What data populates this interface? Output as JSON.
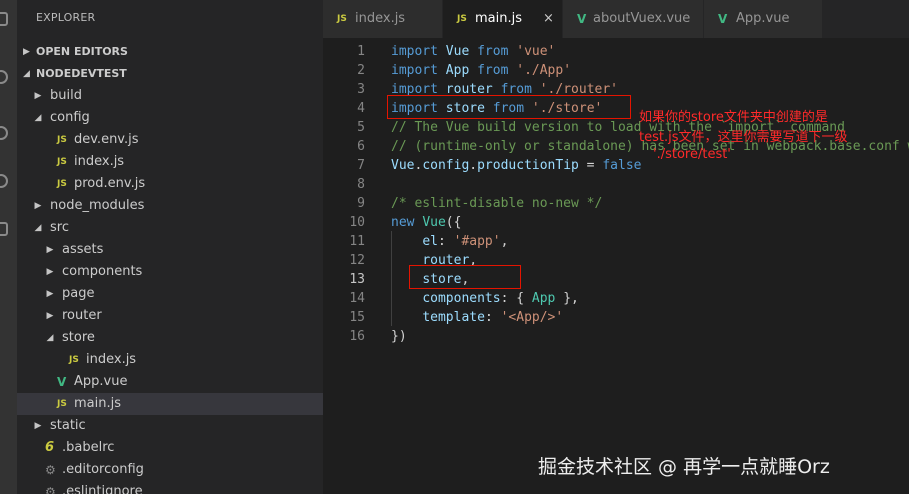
{
  "sidebar": {
    "title": "EXPLORER",
    "open_editors_label": "OPEN EDITORS",
    "project_label": "NODEDEVTEST",
    "tree": [
      {
        "label": "build",
        "kind": "folder",
        "expanded": false
      },
      {
        "label": "config",
        "kind": "folder",
        "expanded": true
      },
      {
        "label": "dev.env.js",
        "kind": "js"
      },
      {
        "label": "index.js",
        "kind": "js"
      },
      {
        "label": "prod.env.js",
        "kind": "js"
      },
      {
        "label": "node_modules",
        "kind": "folder",
        "expanded": false
      },
      {
        "label": "src",
        "kind": "folder",
        "expanded": true
      },
      {
        "label": "assets",
        "kind": "folder",
        "expanded": false
      },
      {
        "label": "components",
        "kind": "folder",
        "expanded": false
      },
      {
        "label": "page",
        "kind": "folder",
        "expanded": false
      },
      {
        "label": "router",
        "kind": "folder",
        "expanded": false
      },
      {
        "label": "store",
        "kind": "folder",
        "expanded": true
      },
      {
        "label": "index.js",
        "kind": "js"
      },
      {
        "label": "App.vue",
        "kind": "vue"
      },
      {
        "label": "main.js",
        "kind": "js",
        "selected": true
      },
      {
        "label": "static",
        "kind": "folder",
        "expanded": false
      },
      {
        "label": ".babelrc",
        "kind": "babel"
      },
      {
        "label": ".editorconfig",
        "kind": "config"
      },
      {
        "label": ".eslintignore",
        "kind": "config"
      }
    ]
  },
  "icons": {
    "js": "JS",
    "vue": "V",
    "babel": "6",
    "config": "⚙",
    "collapsed": "▶",
    "expanded": "◢",
    "close": "×"
  },
  "tabs": [
    {
      "label": "index.js",
      "icon": "JS",
      "active": false
    },
    {
      "label": "main.js",
      "icon": "JS",
      "active": true,
      "close": "×"
    },
    {
      "label": "aboutVuex.vue",
      "icon": "V",
      "active": false
    },
    {
      "label": "App.vue",
      "icon": "V",
      "active": false
    }
  ],
  "editor": {
    "current_line": 13,
    "line_numbers": [
      "1",
      "2",
      "3",
      "4",
      "5",
      "6",
      "7",
      "8",
      "9",
      "10",
      "11",
      "12",
      "13",
      "14",
      "15",
      "16"
    ],
    "lines": [
      [
        {
          "t": "import",
          "c": "kw"
        },
        {
          "t": " ",
          "c": "pl"
        },
        {
          "t": "Vue",
          "c": "id"
        },
        {
          "t": " ",
          "c": "pl"
        },
        {
          "t": "from",
          "c": "kw"
        },
        {
          "t": " ",
          "c": "pl"
        },
        {
          "t": "'vue'",
          "c": "str"
        }
      ],
      [
        {
          "t": "import",
          "c": "kw"
        },
        {
          "t": " ",
          "c": "pl"
        },
        {
          "t": "App",
          "c": "id"
        },
        {
          "t": " ",
          "c": "pl"
        },
        {
          "t": "from",
          "c": "kw"
        },
        {
          "t": " ",
          "c": "pl"
        },
        {
          "t": "'./App'",
          "c": "str"
        }
      ],
      [
        {
          "t": "import",
          "c": "kw"
        },
        {
          "t": " ",
          "c": "pl"
        },
        {
          "t": "router",
          "c": "id"
        },
        {
          "t": " ",
          "c": "pl"
        },
        {
          "t": "from",
          "c": "kw"
        },
        {
          "t": " ",
          "c": "pl"
        },
        {
          "t": "'./router'",
          "c": "str"
        }
      ],
      [
        {
          "t": "import",
          "c": "kw"
        },
        {
          "t": " ",
          "c": "pl"
        },
        {
          "t": "store",
          "c": "id"
        },
        {
          "t": " ",
          "c": "pl"
        },
        {
          "t": "from",
          "c": "kw"
        },
        {
          "t": " ",
          "c": "pl"
        },
        {
          "t": "'./store'",
          "c": "str"
        }
      ],
      [
        {
          "t": "// The Vue build version to load with the `import` command",
          "c": "cmt"
        }
      ],
      [
        {
          "t": "// (runtime-only or standalone) has been set in webpack.base.conf with an alias.",
          "c": "cmt"
        }
      ],
      [
        {
          "t": "Vue",
          "c": "id"
        },
        {
          "t": ".",
          "c": "pl"
        },
        {
          "t": "config",
          "c": "id"
        },
        {
          "t": ".",
          "c": "pl"
        },
        {
          "t": "productionTip",
          "c": "id"
        },
        {
          "t": " = ",
          "c": "pl"
        },
        {
          "t": "false",
          "c": "kw"
        }
      ],
      [],
      [
        {
          "t": "/* eslint-disable no-new */",
          "c": "cmt"
        }
      ],
      [
        {
          "t": "new",
          "c": "kw"
        },
        {
          "t": " ",
          "c": "pl"
        },
        {
          "t": "Vue",
          "c": "cls"
        },
        {
          "t": "({",
          "c": "pl"
        }
      ],
      [
        {
          "t": "    ",
          "c": "pl"
        },
        {
          "t": "el",
          "c": "id"
        },
        {
          "t": ": ",
          "c": "pl"
        },
        {
          "t": "'#app'",
          "c": "str"
        },
        {
          "t": ",",
          "c": "pl"
        }
      ],
      [
        {
          "t": "    ",
          "c": "pl"
        },
        {
          "t": "router",
          "c": "id"
        },
        {
          "t": ",",
          "c": "pl"
        }
      ],
      [
        {
          "t": "    ",
          "c": "pl"
        },
        {
          "t": "store",
          "c": "id"
        },
        {
          "t": ",",
          "c": "pl"
        }
      ],
      [
        {
          "t": "    ",
          "c": "pl"
        },
        {
          "t": "components",
          "c": "id"
        },
        {
          "t": ": { ",
          "c": "pl"
        },
        {
          "t": "App",
          "c": "cls"
        },
        {
          "t": " },",
          "c": "pl"
        }
      ],
      [
        {
          "t": "    ",
          "c": "pl"
        },
        {
          "t": "template",
          "c": "id"
        },
        {
          "t": ": ",
          "c": "pl"
        },
        {
          "t": "'<App/>'",
          "c": "str"
        }
      ],
      [
        {
          "t": "})",
          "c": "pl"
        }
      ]
    ]
  },
  "annotation": {
    "line1": "如果你的store文件夹中创建的是",
    "line2": "test.js文件，这里你需要写道下一级",
    "line3": "'./store/test'"
  },
  "watermark": "掘金技术社区 @ 再学一点就睡Orz",
  "colors": {
    "annotation": "#ff2a2a",
    "highlight_box": "#e51400"
  }
}
